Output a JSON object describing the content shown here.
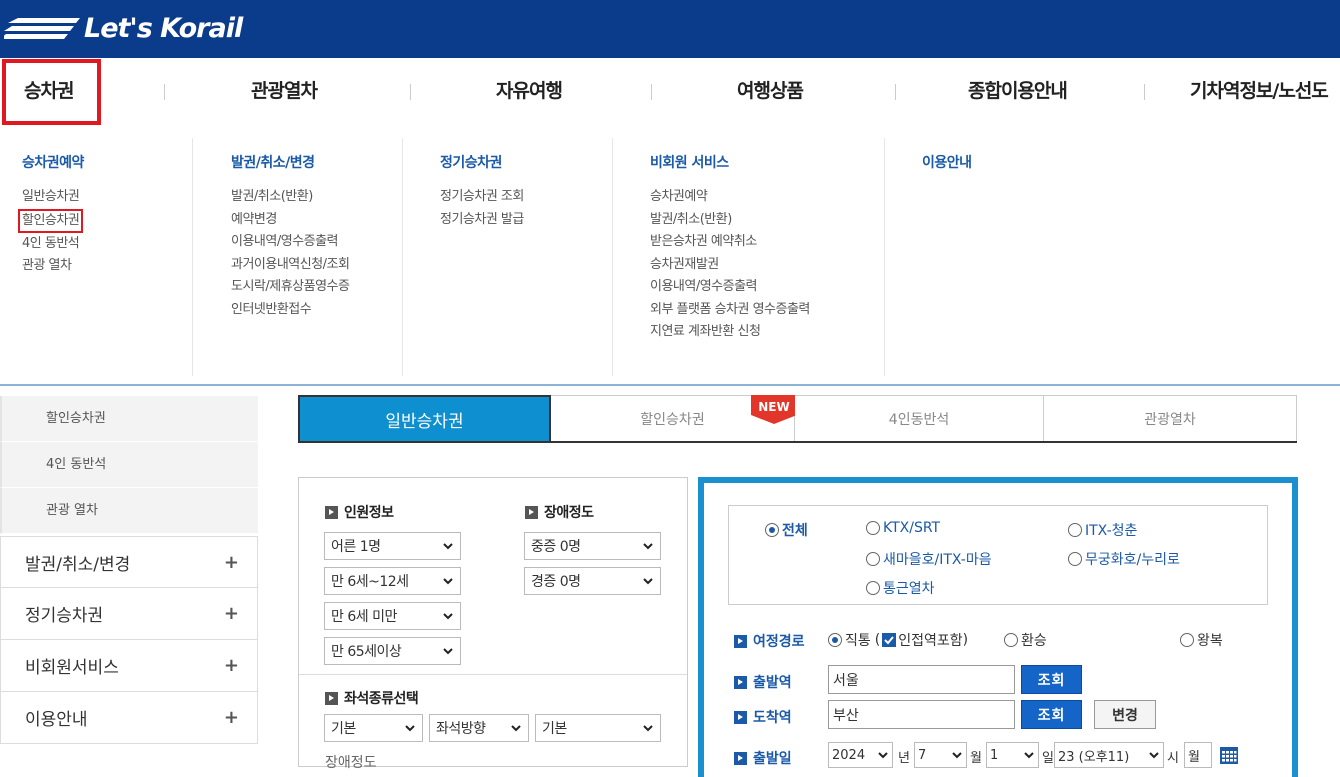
{
  "brand": {
    "name": "Let's Korail",
    "color": "#0b3c8c"
  },
  "gnb": [
    "승차권",
    "관광열차",
    "자유여행",
    "여행상품",
    "종합이용안내",
    "기차역정보/노선도"
  ],
  "mega": {
    "col1": {
      "head": "승차권예약",
      "links": [
        "일반승차권",
        "할인승차권",
        "4인 동반석",
        "관광 열차"
      ]
    },
    "col2": {
      "head": "발권/취소/변경",
      "links": [
        "발권/취소(반환)",
        "예약변경",
        "이용내역/영수증출력",
        "과거이용내역신청/조회",
        "도시락/제휴상품영수증",
        "인터넷반환접수"
      ]
    },
    "col3": {
      "head": "정기승차권",
      "links": [
        "정기승차권 조회",
        "정기승차권 발급"
      ]
    },
    "col4": {
      "head": "비회원 서비스",
      "links": [
        "승차권예약",
        "발권/취소(반환)",
        "받은승차권 예약취소",
        "승차권재발권",
        "이용내역/영수증출력",
        "외부 플랫폼 승차권 영수증출력",
        "지연료 계좌반환 신청"
      ]
    },
    "col5": {
      "head": "이용안내"
    }
  },
  "sidebar": {
    "sub": [
      "할인승차권",
      "4인 동반석",
      "관광 열차"
    ],
    "items": [
      "발권/취소/변경",
      "정기승차권",
      "비회원서비스",
      "이용안내"
    ],
    "plus": "+"
  },
  "tabs": [
    "일반승차권",
    "할인승차권",
    "4인동반석",
    "관광열차"
  ],
  "new_badge": "NEW",
  "passenger": {
    "label": "인원정보",
    "adult": "어른 1명",
    "child": "만 6세~12세",
    "infant": "만 6세 미만",
    "senior": "만 65세이상"
  },
  "disability": {
    "label": "장애정도",
    "severe": "중증 0명",
    "mild": "경증 0명"
  },
  "seat": {
    "label": "좌석종류선택",
    "type": "기본",
    "direction": "좌석방향",
    "position": "기본",
    "cut_label": "장애정도"
  },
  "train_types": [
    "전체",
    "KTX/SRT",
    "ITX-청춘",
    "새마을호/ITX-마음",
    "무궁화호/누리로",
    "통근열차"
  ],
  "route": {
    "label": "여정경로",
    "direct": "직통",
    "adjacent": "인접역포함",
    "paren_open": "(",
    "paren_close": ")",
    "transfer": "환승",
    "roundtrip": "왕복"
  },
  "departure": {
    "label": "출발역",
    "value": "서울",
    "btn": "조회"
  },
  "arrival": {
    "label": "도착역",
    "value": "부산",
    "btn": "조회",
    "swap": "변경"
  },
  "date": {
    "label": "출발일",
    "year": "2024",
    "year_unit": "년",
    "month": "7",
    "month_unit": "월",
    "day": "1",
    "day_unit": "일",
    "hour": "23 (오후11)",
    "hour_unit": "시",
    "weekday": "월"
  }
}
